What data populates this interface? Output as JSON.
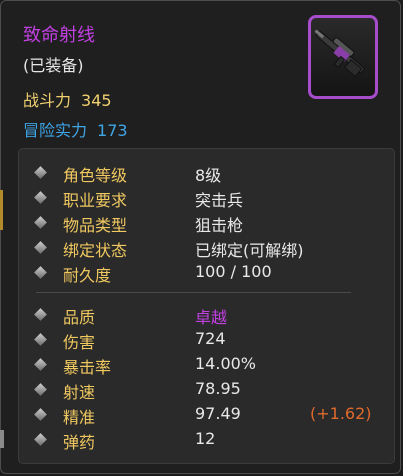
{
  "item": {
    "name": "致命射线",
    "equipped": "(已装备)",
    "power_label": "战斗力",
    "power_value": "345",
    "adventure_label": "冒险实力",
    "adventure_value": "173",
    "icon": "sniper-rifle-icon"
  },
  "attributes": [
    {
      "label": "角色等级",
      "value": "8级"
    },
    {
      "label": "职业要求",
      "value": "突击兵"
    },
    {
      "label": "物品类型",
      "value": "狙击枪"
    },
    {
      "label": "绑定状态",
      "value": "已绑定(可解绑)"
    },
    {
      "label": "耐久度",
      "value": "100 / 100"
    }
  ],
  "stats": [
    {
      "label": "品质",
      "value": "卓越"
    },
    {
      "label": "伤害",
      "value": "724"
    },
    {
      "label": "暴击率",
      "value": "14.00%"
    },
    {
      "label": "射速",
      "value": "78.95"
    },
    {
      "label": "精准",
      "value": "97.49",
      "bonus": "(+1.62)"
    },
    {
      "label": "弹药",
      "value": "12"
    }
  ],
  "colors": {
    "quality_purple": "#c040e0",
    "label_gold": "#f0c860",
    "adventure_blue": "#3fa6e6",
    "bonus_orange": "#e06a2c"
  }
}
